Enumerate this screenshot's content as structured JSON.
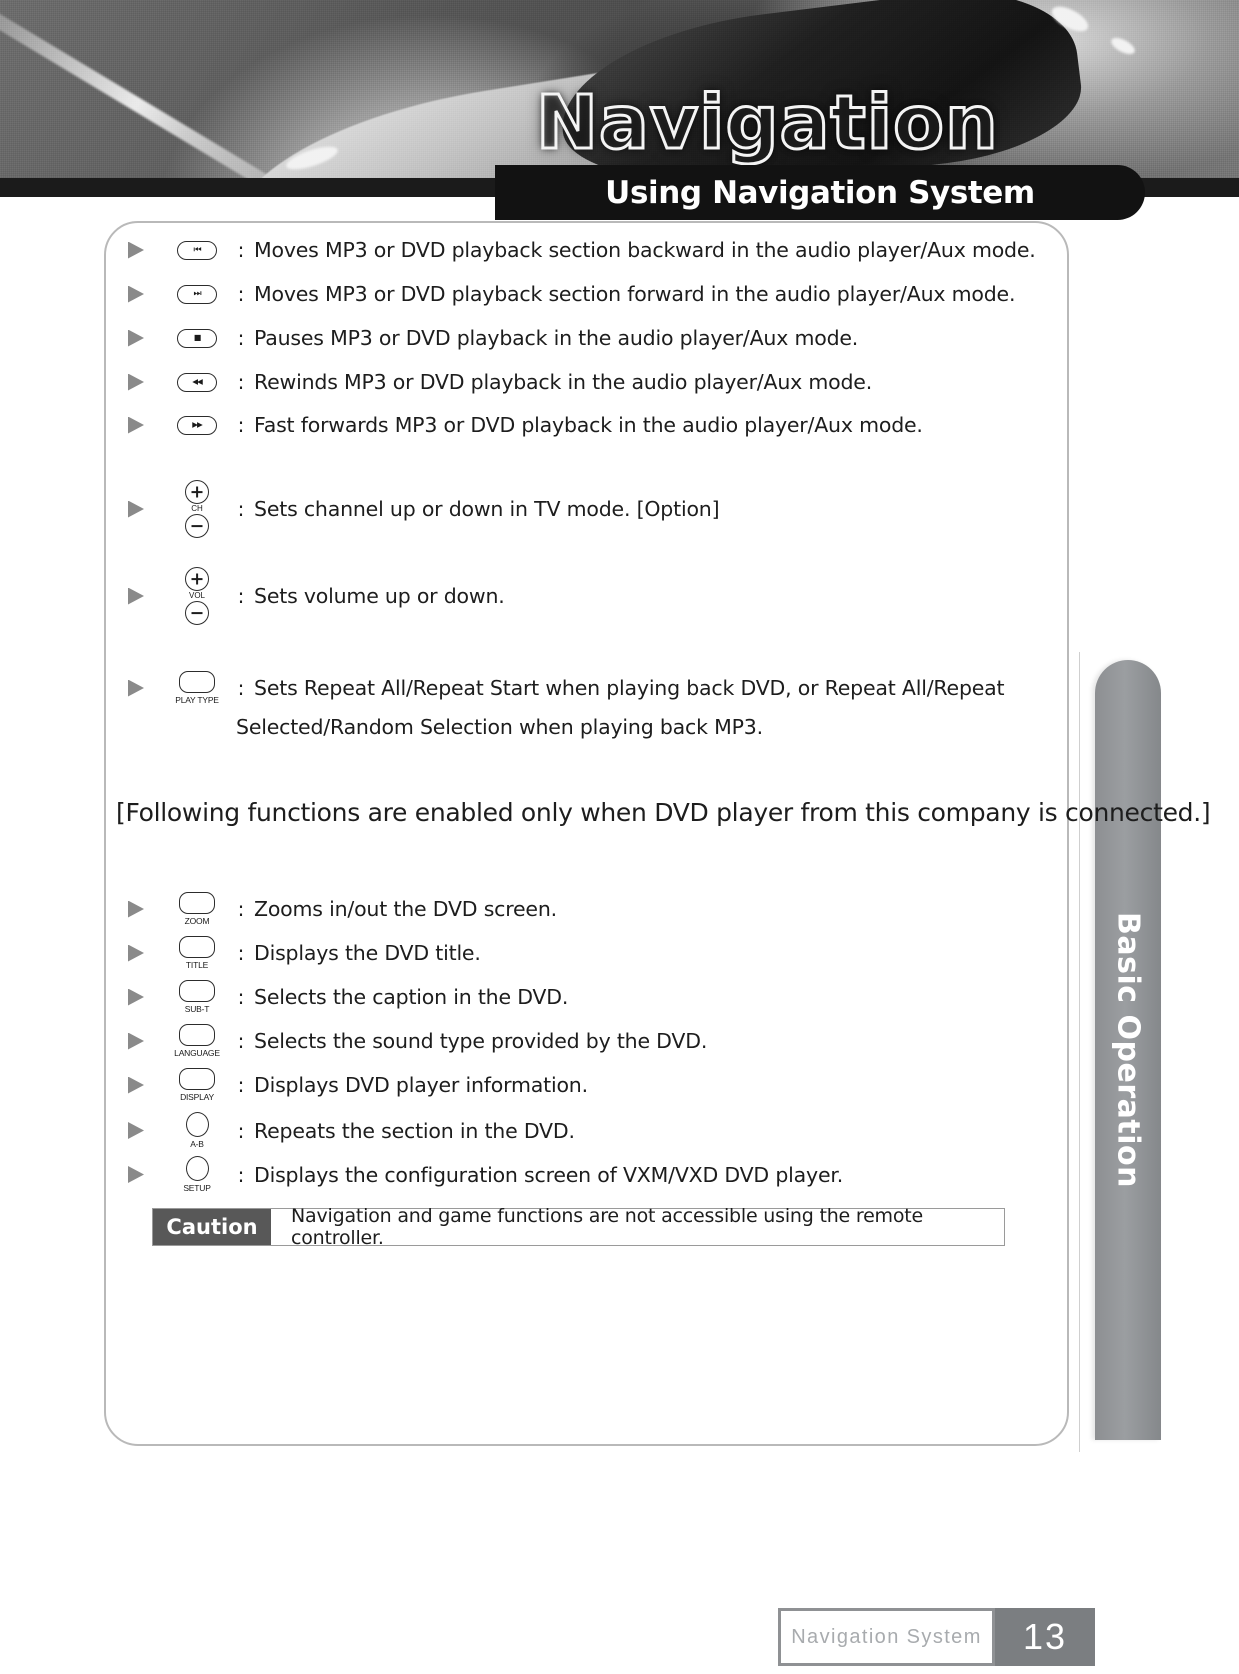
{
  "header": {
    "wordmark": "Navigation",
    "title": "Using Navigation System"
  },
  "side_tab": {
    "label": "Basic Operation"
  },
  "colors": {
    "title_pill_bg": "#121212",
    "side_tab_bg": "#8d8f92",
    "caution_label_bg": "#585858",
    "arrow": "#8a8a8a",
    "page_box_bg": "#7b7e81"
  },
  "list_top": [
    {
      "icon": "prev-track-icon",
      "glyph": "⏮",
      "colon": ":",
      "text": "Moves MP3 or DVD playback section backward in the audio player/Aux mode."
    },
    {
      "icon": "next-track-icon",
      "glyph": "⏭",
      "colon": ":",
      "text": "Moves MP3 or DVD playback section forward in the audio player/Aux mode."
    },
    {
      "icon": "pause-stop-icon",
      "glyph": "■",
      "colon": ":",
      "text": "Pauses MP3 or DVD playback in the audio player/Aux mode."
    },
    {
      "icon": "rewind-icon",
      "glyph": "◀◀",
      "colon": ":",
      "text": "Rewinds MP3 or DVD playback in the audio player/Aux mode."
    },
    {
      "icon": "fast-forward-icon",
      "glyph": "▶▶",
      "colon": ":",
      "text": "Fast forwards MP3 or DVD playback in the audio player/Aux mode."
    }
  ],
  "list_stacked": [
    {
      "icon": "channel-updown-icon",
      "label": "CH",
      "colon": ":",
      "text": "Sets channel up or down in TV mode. [Option]"
    },
    {
      "icon": "volume-updown-icon",
      "label": "VOL",
      "colon": ":",
      "text": "Sets volume up or down."
    }
  ],
  "play_type": {
    "icon": "play-type-button-icon",
    "label": "PLAY TYPE",
    "colon": ":",
    "text": "Sets Repeat All/Repeat Start when playing back DVD, or Repeat All/Repeat",
    "text_line2": "Selected/Random Selection when playing back MP3."
  },
  "bracket_heading": "[Following functions are enabled only when DVD player from this company is connected.]",
  "list_dvd": [
    {
      "icon": "zoom-button-icon",
      "shape": "pill",
      "label": "ZOOM",
      "colon": ":",
      "text": "Zooms in/out the DVD screen."
    },
    {
      "icon": "title-button-icon",
      "shape": "pill",
      "label": "TITLE",
      "colon": ":",
      "text": "Displays the DVD title."
    },
    {
      "icon": "subtitle-button-icon",
      "shape": "pill",
      "label": "SUB-T",
      "colon": ":",
      "text": "Selects the caption in the DVD."
    },
    {
      "icon": "language-button-icon",
      "shape": "pill",
      "label": "LANGUAGE",
      "colon": ":",
      "text": "Selects the sound type provided by the DVD."
    },
    {
      "icon": "display-button-icon",
      "shape": "pill",
      "label": "DISPLAY",
      "colon": ":",
      "text": "Displays DVD player information."
    },
    {
      "icon": "ab-repeat-button-icon",
      "shape": "circle",
      "label": "A-B",
      "colon": ":",
      "text": "Repeats the section in the DVD."
    },
    {
      "icon": "setup-button-icon",
      "shape": "circle",
      "label": "SETUP",
      "colon": ":",
      "text": "Displays the configuration screen of VXM/VXD DVD player."
    }
  ],
  "caution": {
    "label": "Caution",
    "text": "Navigation and game functions are not accessible using the remote controller."
  },
  "footer": {
    "manual_name": "Navigation System",
    "page_number": "13"
  }
}
